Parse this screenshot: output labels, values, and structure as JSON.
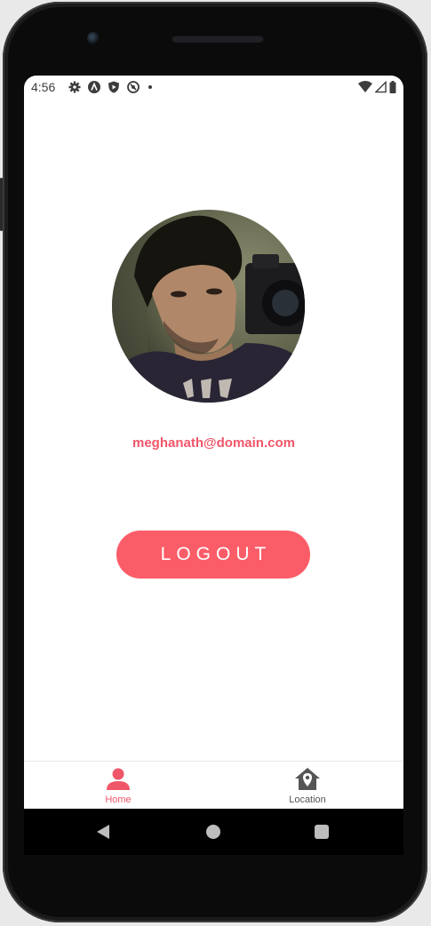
{
  "status_bar": {
    "time": "4:56",
    "left_icons": [
      "gear-icon",
      "a-icon",
      "shield-play-icon",
      "sync-icon",
      "dot-icon"
    ],
    "right_icons": [
      "wifi-icon",
      "signal-icon",
      "battery-icon"
    ]
  },
  "profile": {
    "avatar_alt": "profile-photo",
    "email": "meghanath@domain.com"
  },
  "actions": {
    "logout_label": "LOGOUT"
  },
  "bottom_nav": {
    "items": [
      {
        "label": "Home",
        "icon": "person-icon",
        "active": true
      },
      {
        "label": "Location",
        "icon": "home-location-icon",
        "active": false
      }
    ]
  },
  "colors": {
    "accent": "#fb5d68",
    "accent_text": "#f0566a",
    "inactive": "#555555"
  }
}
